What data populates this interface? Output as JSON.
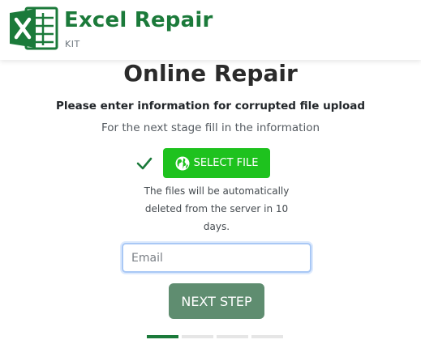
{
  "brand": {
    "name": "Excel Repair",
    "sub": "KIT",
    "logo_icon": "excel-icon"
  },
  "main": {
    "title": "Online Repair",
    "subtitle": "Please enter information for corrupted file upload",
    "hint": "For the next stage fill in the information",
    "select_file_label": "SELECT FILE",
    "select_file_icon": "globe-icon",
    "file_status_icon": "check-icon",
    "note": "The files will be automatically deleted from the server in 10 days.",
    "email_placeholder": "Email",
    "next_label": "NEXT STEP"
  },
  "progress": {
    "total_steps": 4,
    "current_step": 1
  },
  "colors": {
    "brand_green": "#1b7a3a",
    "select_button": "#1ec21e",
    "next_button": "#5f8d70",
    "input_focus_border": "#a9c8f5"
  }
}
